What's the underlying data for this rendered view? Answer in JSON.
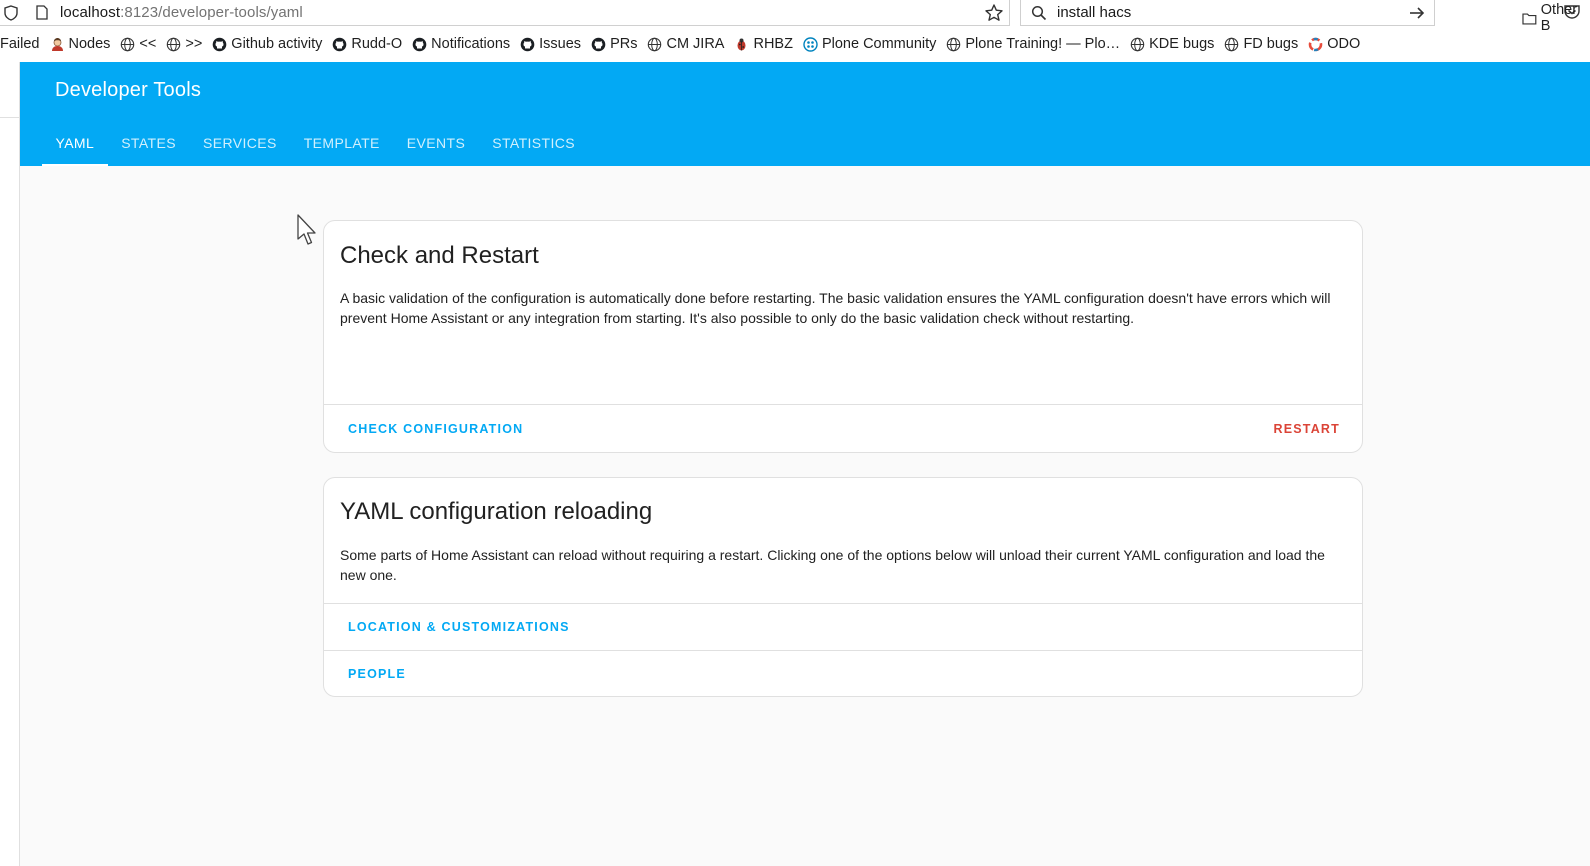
{
  "browser": {
    "url_host": "localhost",
    "url_rest": ":8123/developer-tools/yaml",
    "search_value": "install hacs",
    "bookmarks": [
      {
        "label": "Failed",
        "icon": "none"
      },
      {
        "label": "Nodes",
        "icon": "avatar-icon"
      },
      {
        "label": "<<",
        "icon": "globe-icon"
      },
      {
        "label": ">>",
        "icon": "globe-icon"
      },
      {
        "label": "Github activity",
        "icon": "github-icon"
      },
      {
        "label": "Rudd-O",
        "icon": "github-icon"
      },
      {
        "label": "Notifications",
        "icon": "github-icon"
      },
      {
        "label": "Issues",
        "icon": "github-icon"
      },
      {
        "label": "PRs",
        "icon": "github-icon"
      },
      {
        "label": "CM JIRA",
        "icon": "globe-icon"
      },
      {
        "label": "RHBZ",
        "icon": "bug-icon"
      },
      {
        "label": "Plone Community",
        "icon": "plone-icon"
      },
      {
        "label": "Plone Training! — Plo…",
        "icon": "globe-icon"
      },
      {
        "label": "KDE bugs",
        "icon": "globe-icon"
      },
      {
        "label": "FD bugs",
        "icon": "globe-icon"
      },
      {
        "label": "ODO",
        "icon": "odo-icon"
      }
    ],
    "other_bookmarks": "Other B"
  },
  "header": {
    "title": "Developer Tools",
    "accent_color": "#03a9f4",
    "tabs": [
      {
        "label": "YAML",
        "active": true
      },
      {
        "label": "STATES",
        "active": false
      },
      {
        "label": "SERVICES",
        "active": false
      },
      {
        "label": "TEMPLATE",
        "active": false
      },
      {
        "label": "EVENTS",
        "active": false
      },
      {
        "label": "STATISTICS",
        "active": false
      }
    ]
  },
  "check_card": {
    "title": "Check and Restart",
    "description": "A basic validation of the configuration is automatically done before restarting. The basic validation ensures the YAML configuration doesn't have errors which will prevent Home Assistant or any integration from starting. It's also possible to only do the basic validation check without restarting.",
    "check_label": "CHECK CONFIGURATION",
    "restart_label": "RESTART",
    "restart_color": "#db4437"
  },
  "reload_card": {
    "title": "YAML configuration reloading",
    "description": "Some parts of Home Assistant can reload without requiring a restart. Clicking one of the options below will unload their current YAML configuration and load the new one.",
    "options": [
      "LOCATION & CUSTOMIZATIONS",
      "PEOPLE"
    ]
  }
}
